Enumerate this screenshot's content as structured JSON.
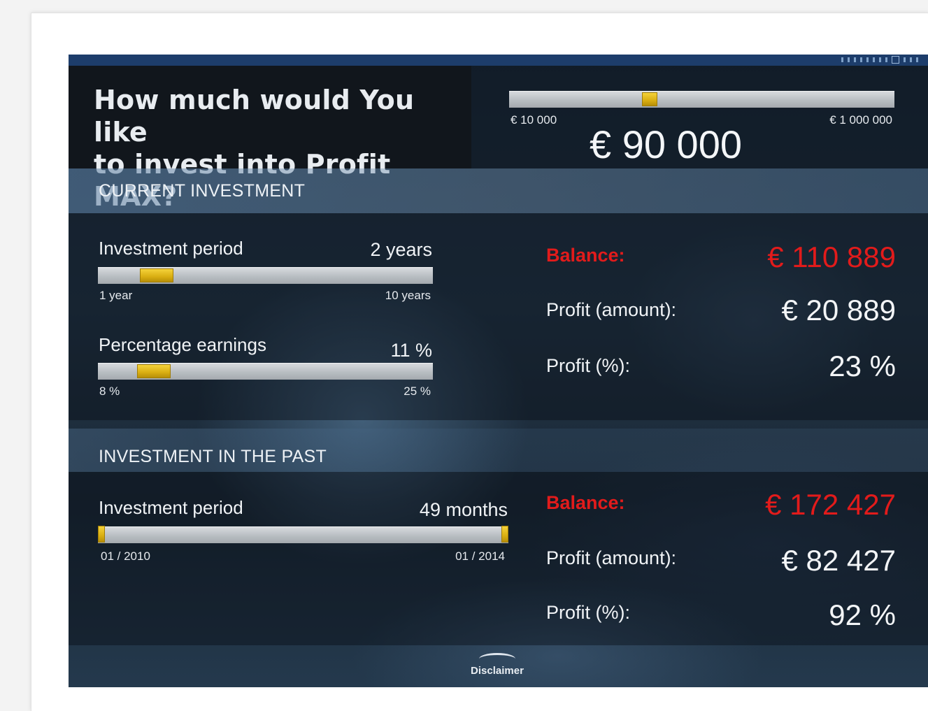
{
  "question": {
    "title_line1": "How much would You like",
    "title_line2": "to invest into Profit MAX?"
  },
  "amount_slider": {
    "min_label": "€ 10 000",
    "max_label": "€ 1 000 000",
    "value": "€ 90 000",
    "position_fraction": 0.36
  },
  "current": {
    "section_title": "CURRENT INVESTMENT",
    "period": {
      "label": "Investment period",
      "value": "2 years",
      "min_label": "1 year",
      "max_label": "10 years",
      "position_fraction": 0.14
    },
    "earnings": {
      "label": "Percentage earnings",
      "value": "11 %",
      "min_label": "8 %",
      "max_label": "25 %",
      "position_fraction": 0.13
    },
    "balance_label": "Balance:",
    "balance_value": "€ 110 889",
    "profit_amount_label": "Profit (amount):",
    "profit_amount_value": "€ 20 889",
    "profit_pct_label": "Profit (%):",
    "profit_pct_value": "23 %"
  },
  "past": {
    "section_title": "INVESTMENT IN THE PAST",
    "period": {
      "label": "Investment period",
      "value": "49 months",
      "min_label": "01 / 2010",
      "max_label": "01 / 2014",
      "start_fraction": 0.0,
      "end_fraction": 1.0
    },
    "balance_label": "Balance:",
    "balance_value": "€ 172 427",
    "profit_amount_label": "Profit (amount):",
    "profit_amount_value": "€ 82 427",
    "profit_pct_label": "Profit (%):",
    "profit_pct_value": "92 %"
  },
  "footer": {
    "disclaimer_label": "Disclaimer"
  },
  "colors": {
    "accent_red": "#e21b1b",
    "slider_thumb": "#e3b51a",
    "top_bar": "#1d3d6b"
  }
}
